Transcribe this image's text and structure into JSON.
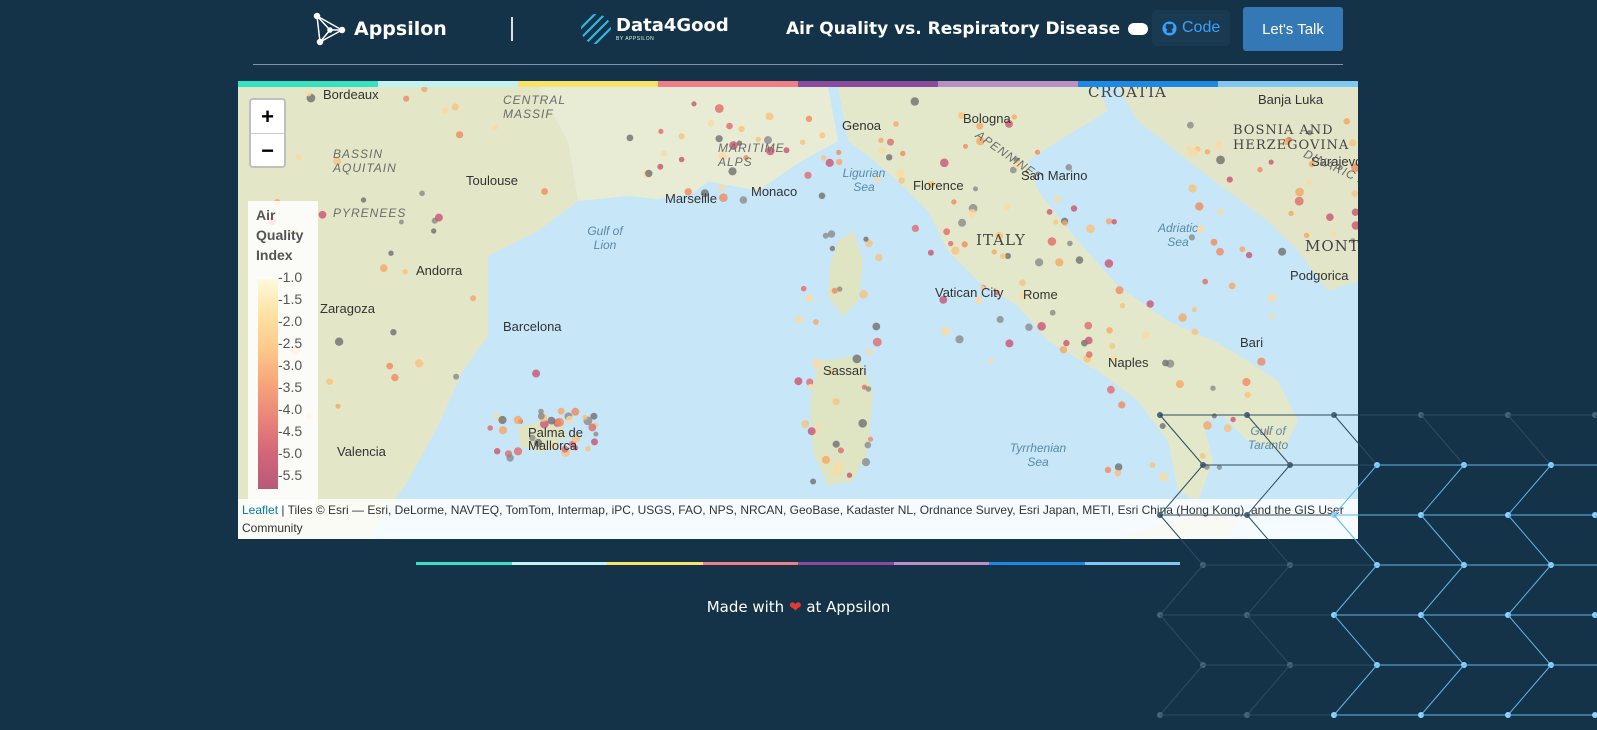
{
  "header": {
    "appsilon_brand": "Appsilon",
    "d4g_brand": "Data4Good",
    "d4g_sub": "BY APPSILON",
    "title": "Air Quality vs. Respiratory Disease",
    "code_label": "Code",
    "talk_label": "Let's Talk"
  },
  "accent_colors": [
    "#37e2c3",
    "#c3f2f0",
    "#f7e26b",
    "#ee7f86",
    "#8a4a9e",
    "#bb8ec5",
    "#1e88e5",
    "#7ec8f2"
  ],
  "map": {
    "zoom_in": "+",
    "zoom_out": "−",
    "legend": {
      "title": "Air Quality Index",
      "ticks": [
        "1.0",
        "1.5",
        "2.0",
        "2.5",
        "3.0",
        "3.5",
        "4.0",
        "4.5",
        "5.0",
        "5.5"
      ]
    },
    "attribution_link": "Leaflet",
    "attribution_text": " | Tiles © Esri — Esri, DeLorme, NAVTEQ, TomTom, Intermap, iPC, USGS, FAO, NPS, NRCAN, GeoBase, Kadaster NL, Ordnance Survey, Esri Japan, METI, Esri China (Hong Kong), and the GIS User Community",
    "labels": {
      "bordeaux": "Bordeaux",
      "central_massif": "CENTRAL MASSIF",
      "bassin": "BASSIN AQUITAIN",
      "toulouse": "Toulouse",
      "pyrenees": "PYRENEES",
      "andorra": "Andorra",
      "zaragoza": "Zaragoza",
      "barcelona": "Barcelona",
      "valencia": "Valencia",
      "palma": "Palma de Mallorca",
      "marseille": "Marseille",
      "monaco": "Monaco",
      "gulf_lion": "Gulf of Lion",
      "maritime": "MARITIME ALPS",
      "genoa": "Genoa",
      "ligurian": "Ligurian Sea",
      "florence": "Florence",
      "bologna": "Bologna",
      "apennines": "APENNINES",
      "san_marino": "San Marino",
      "italy": "ITALY",
      "vatican": "Vatican City",
      "rome": "Rome",
      "sassari": "Sassari",
      "tyrrhenian": "Tyrrhenian Sea",
      "naples": "Naples",
      "bari": "Bari",
      "taranto": "Gulf of Taranto",
      "adriatic": "Adriatic Sea",
      "croatia": "CROATIA",
      "banja": "Banja Luka",
      "bosnia": "BOSNIA AND HERZEGOVINA",
      "sarajevo": "Sarajevo",
      "dinaric": "DINARIC ALPS",
      "monte": "MONTE",
      "podgorica": "Podgorica"
    }
  },
  "footer": {
    "made_with": "Made with",
    "at": "at Appsilon"
  }
}
